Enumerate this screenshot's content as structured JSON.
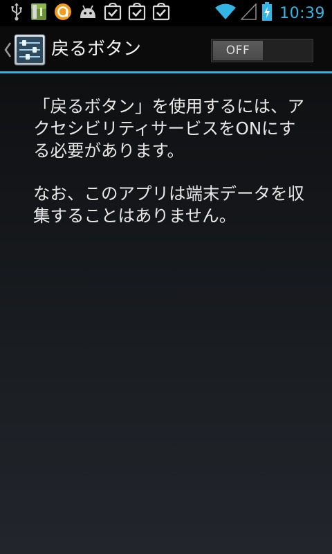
{
  "status_bar": {
    "notification_icons": [
      "usb-icon",
      "battery-app-icon",
      "orange-circle-app-icon",
      "android-icon",
      "download-complete-icon",
      "download-complete-icon",
      "download-complete-icon"
    ],
    "time": "10:39",
    "accent_color": "#33b5e5"
  },
  "action_bar": {
    "title": "戻るボタン",
    "toggle": {
      "label": "OFF",
      "state": "off"
    }
  },
  "content": {
    "paragraph1": "「戻るボタン」を使用するには、アクセシビリティサービスをONにする必要があります。",
    "paragraph2": "なお、このアプリは端末データを収集することはありません。"
  }
}
